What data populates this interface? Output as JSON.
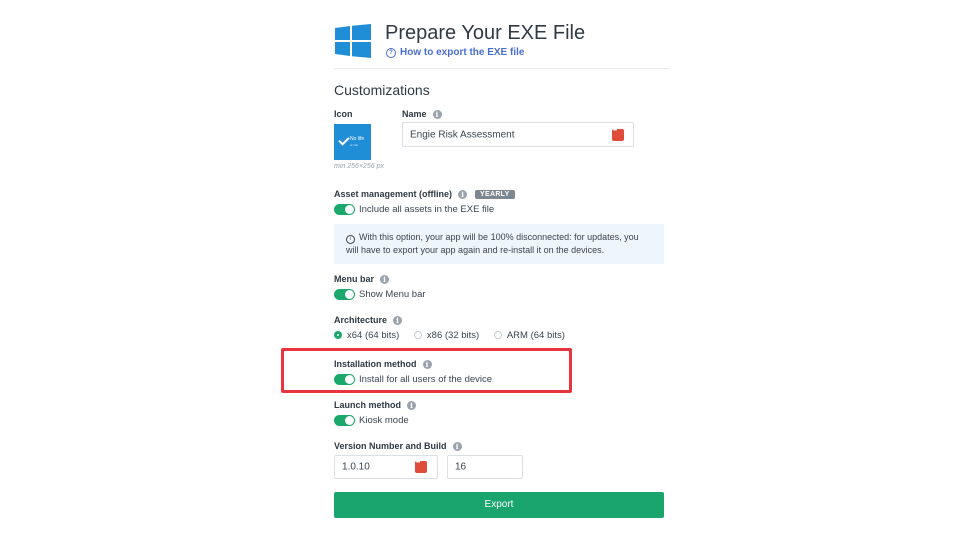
{
  "header": {
    "title": "Prepare Your EXE File",
    "help_link": "How to export the EXE file"
  },
  "customizations": {
    "section_title": "Customizations",
    "icon": {
      "label": "Icon",
      "thumb_text_1": "No life",
      "thumb_text_2": "at risk",
      "min_size": "min 256×256 px"
    },
    "name": {
      "label": "Name",
      "value": "Engie Risk Assessment"
    },
    "asset_management": {
      "label": "Asset management (offline)",
      "badge": "YEARLY",
      "toggle_label": "Include all assets in the EXE file",
      "enabled": true,
      "notice_line1": "With this option, your app will be 100% disconnected: for updates, you",
      "notice_line2": "will have to export your app again and re-install it on the devices."
    },
    "menu_bar": {
      "label": "Menu bar",
      "toggle_label": "Show Menu bar",
      "enabled": true
    },
    "architecture": {
      "label": "Architecture",
      "options": [
        "x64 (64 bits)",
        "x86 (32 bits)",
        "ARM (64 bits)"
      ],
      "selected": "x64 (64 bits)"
    },
    "installation_method": {
      "label": "Installation method",
      "toggle_label": "Install for all users of the device",
      "enabled": true
    },
    "launch_method": {
      "label": "Launch method",
      "toggle_label": "Kiosk mode",
      "enabled": true
    },
    "version": {
      "label": "Version Number and Build",
      "version_value": "1.0.10",
      "build_value": "16"
    }
  },
  "export_button": "Export",
  "colors": {
    "accent": "#1aa56e",
    "link": "#4a6ed0",
    "highlight": "#e8343e",
    "windows_blue": "#1f8ed6"
  }
}
